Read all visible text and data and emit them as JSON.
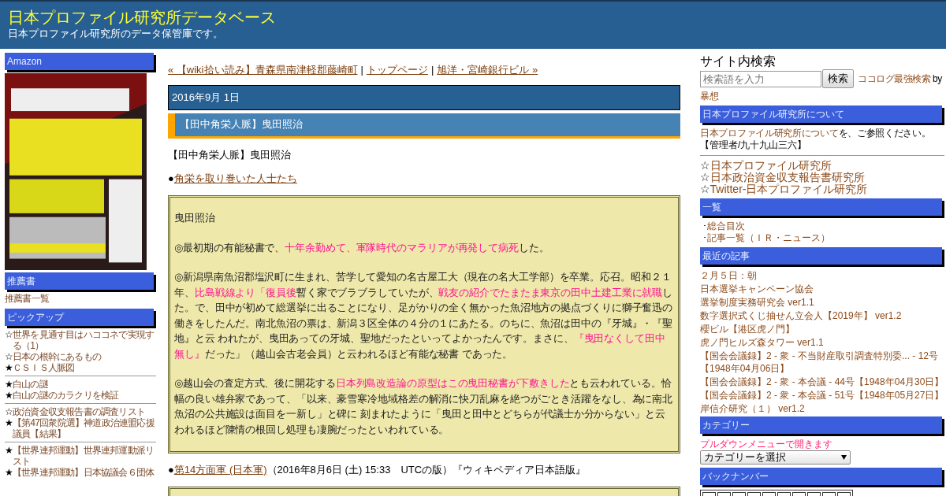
{
  "header": {
    "title": "日本プロファイル研究所データベース",
    "subtitle": "日本プロファイル研究所のデータ保管庫です。"
  },
  "left_sidebar": {
    "sections": [
      {
        "heading": "Amazon",
        "kind": "picture"
      },
      {
        "heading": "推薦書",
        "kind": "links",
        "groups": [
          [
            {
              "label": "推薦書一覧"
            }
          ]
        ]
      },
      {
        "heading": "ピックアップ",
        "kind": "links",
        "groups": [
          [
            {
              "mark": "☆",
              "label": "世界を見通す目はハココネで実現する（1）"
            },
            {
              "mark": "☆",
              "label": "日本の根幹にあるもの"
            },
            {
              "mark": "★",
              "label": "ＣＳＩＳ人脈図"
            }
          ],
          [
            {
              "mark": "★",
              "label": "白山の謎"
            },
            {
              "mark": "★",
              "label": "白山の謎のカラクリを検証"
            }
          ],
          [
            {
              "mark": "☆",
              "label": "政治資金収支報告書の調査リスト"
            },
            {
              "mark": "★",
              "label": "【第47回衆院選】神道政治連盟応援議員【結果】"
            }
          ],
          [
            {
              "mark": "★",
              "label": "【世界連邦運動】世界連邦運動派リスト"
            },
            {
              "mark": "★",
              "label": "【世界連邦運動】日本協議会６団体"
            }
          ]
        ]
      }
    ]
  },
  "main": {
    "nav": [
      {
        "kind": "link",
        "text": "« 【wiki拾い読み】青森県南津軽郡藤崎町"
      },
      {
        "kind": "separator",
        "text": "|"
      },
      {
        "kind": "link",
        "text": "トップページ"
      },
      {
        "kind": "separator",
        "text": "|"
      },
      {
        "kind": "link",
        "text": "旭洋・宮崎銀行ビル »"
      }
    ],
    "date": "2016年9月 1日",
    "entry_title": "【田中角栄人脈】曳田照治",
    "body": [
      {
        "kind": "text",
        "text": "【田中角栄人脈】曳田照治"
      },
      {
        "kind": "bullet_link",
        "bullet": "●",
        "link": "角栄を取り巻いた人士たち"
      },
      {
        "kind": "quote",
        "paragraphs": [
          [
            {
              "text": "曳田照治",
              "highlight": false
            }
          ],
          [
            {
              "text": "◎最初期の有能秘書で、",
              "highlight": false
            },
            {
              "text": "十年余勤めて、軍隊時代のマラリアが再発して病死",
              "highlight": true
            },
            {
              "text": "した。",
              "highlight": false
            }
          ],
          [
            {
              "text": "◎新潟県南魚沼郡塩沢町に生まれ、苦学して愛知の名古屋工大（現在の名大工学部）を卒業。応召。昭和２１年、",
              "highlight": false
            },
            {
              "text": "比島戦線より「復員後",
              "highlight": true
            },
            {
              "text": "暫く家でブラブラしていたが、",
              "highlight": false
            },
            {
              "text": "戦友の紹介でたまたま東京の田中土建工業に就職",
              "highlight": true
            },
            {
              "text": "した。で、田中が初めて総選挙に出ることになり、足がかりの全く無かった魚沼地方の拠点づくりに獅子奮迅の働きをしたんだ。南北魚沼の票は、新潟３区全体の４分の１にあたる。のちに、魚沼は田中の『牙城』・『聖地』と云 われたが、曳田あっての牙城、聖地だったといってよかったんです。まさに、",
              "highlight": false
            },
            {
              "text": "『曳田なくして田中無し』",
              "highlight": true
            },
            {
              "text": "だった」（越山会古老会員）と云われるほど有能な秘書 であった。",
              "highlight": false
            }
          ],
          [
            {
              "text": "◎越山会の査定方式、後に開花する",
              "highlight": false
            },
            {
              "text": "日本列島改造論の原型はこの曳田秘書が下敷きした",
              "highlight": true
            },
            {
              "text": "とも云われている。恰幅の良い雄弁家であって、「以来、豪雪寒冷地域格差の解消に快刀乱麻を絶つがごとき活躍をなし、為に南北魚沼の公共施設は面目を一新し」と碑に 刻まれたように「曳田と田中とどちらが代議士か分からない」と云われるほど陳情の根回し処理も凄腕だったといわれている。",
              "highlight": false
            }
          ]
        ]
      },
      {
        "kind": "bullet_link",
        "bullet": "●",
        "link": "第14方面軍 (日本軍)",
        "rest": "（2016年8月6日 (土) 15:33　UTCの版）『ウィキペディア日本語版』"
      },
      {
        "kind": "quote"
      }
    ]
  },
  "right_sidebar": {
    "search": {
      "heading": "サイト内検索",
      "placeholder": "検索語を入力",
      "button": "検索",
      "link": "ココログ最強検索",
      "by": "by",
      "author": "暴想"
    },
    "sections": [
      {
        "heading": "日本プロファイル研究所について",
        "kind": "about",
        "link": "日本プロファイル研究所について",
        "text": "を、ご参照ください。",
        "note": "【管理者/九十九山三六】",
        "big_links": [
          {
            "mark": "☆",
            "label": "日本プロファイル研究所"
          },
          {
            "mark": "☆",
            "label": "日本政治資金収支報告書研究所"
          },
          {
            "mark": "☆",
            "label": "Twitter-日本プロファイル研究所"
          }
        ]
      },
      {
        "heading": "一覧",
        "kind": "dotlist",
        "items": [
          {
            "mark": "･",
            "label": "総合目次"
          },
          {
            "mark": "･",
            "label": "記事一覧（ＩＲ・ニュース）"
          }
        ]
      },
      {
        "heading": "最近の記事",
        "kind": "list",
        "items": [
          "２月５日：朝",
          "日本選挙キャンペーン協会",
          "選挙制度実務研究会 ver1.1",
          "数字選択式くじ抽せん立会人【2019年】 ver1.2",
          "櫻ビル【港区虎ノ門】",
          "虎ノ門ヒルズ森タワー ver1.1",
          "【国会会議録】2 - 衆 - 不当財産取引調査特別委... - 12号【1948年04月06日】",
          "【国会会議録】2 - 衆 - 本会議 - 44号【1948年04月30日】",
          "【国会会議録】2 - 衆 - 本会議 - 51号【1948年05月27日】",
          "岸信介研究（１） ver1.2"
        ]
      },
      {
        "heading": "カテゴリー",
        "kind": "select",
        "hint": "プルダウンメニューで開きます",
        "value": "カテゴリーを選択"
      },
      {
        "heading": "バックナンバー",
        "kind": "calendar"
      }
    ]
  }
}
